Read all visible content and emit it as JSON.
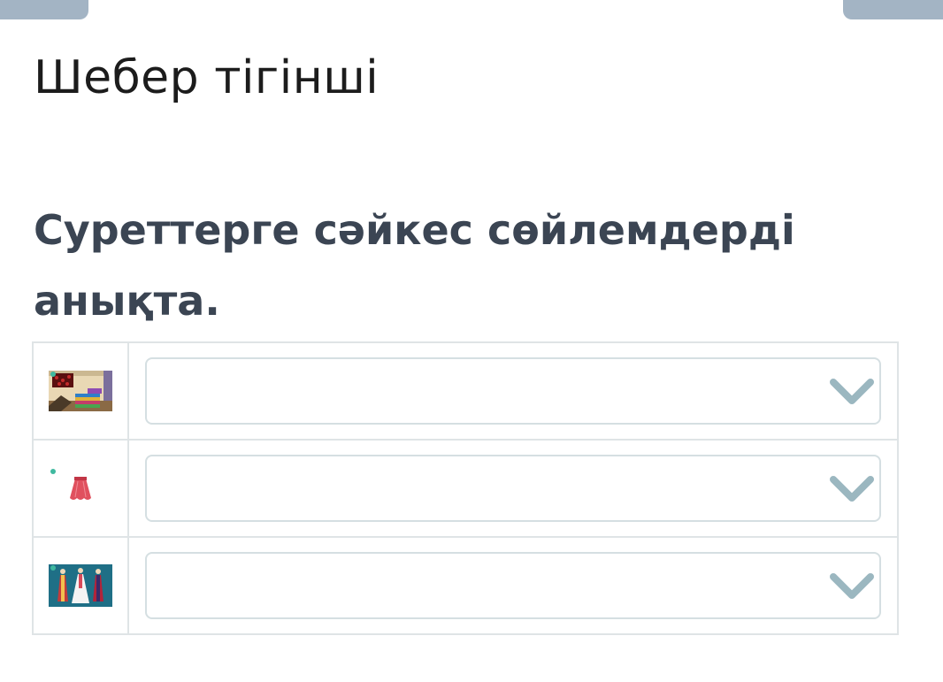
{
  "page": {
    "title": "Шебер тігінші",
    "instruction": "Суреттерге сәйкес сөйлемдерді анықта."
  },
  "colors": {
    "accent_tabs": "#a3b4c4",
    "chevron": "#9bb7c0",
    "border": "#dfe4e6",
    "instruction_text": "#3b4553"
  },
  "rows": [
    {
      "image_name": "fabrics-room-image",
      "selected": "",
      "icon": "chevron-down-icon"
    },
    {
      "image_name": "red-skirt-image",
      "selected": "",
      "icon": "chevron-down-icon"
    },
    {
      "image_name": "national-costumes-image",
      "selected": "",
      "icon": "chevron-down-icon"
    }
  ]
}
